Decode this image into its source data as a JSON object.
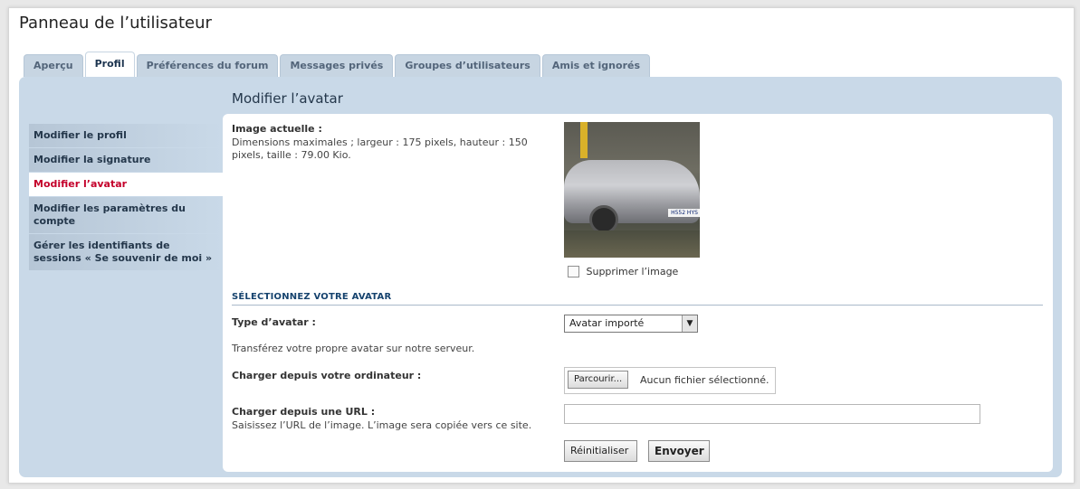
{
  "page": {
    "title": "Panneau de l’utilisateur"
  },
  "tabs": [
    {
      "label": "Aperçu"
    },
    {
      "label": "Profil"
    },
    {
      "label": "Préférences du forum"
    },
    {
      "label": "Messages privés"
    },
    {
      "label": "Groupes d’utilisateurs"
    },
    {
      "label": "Amis et ignorés"
    }
  ],
  "sidebar": {
    "items": [
      {
        "label": "Modifier le profil"
      },
      {
        "label": "Modifier la signature"
      },
      {
        "label": "Modifier l’avatar"
      },
      {
        "label": "Modifier les paramètres du compte"
      },
      {
        "label": "Gérer les identifiants de sessions « Se souvenir de moi »"
      }
    ]
  },
  "main": {
    "heading": "Modifier l’avatar",
    "current_image_label": "Image actuelle :",
    "current_image_desc": "Dimensions maximales ; largeur : 175 pixels, hauteur : 150 pixels, taille : 79.00 Kio.",
    "avatar_plate_text": "H552 HYS",
    "delete_image_label": "Supprimer l’image",
    "section_title": "SÉLECTIONNEZ VOTRE AVATAR",
    "avatar_type_label": "Type d’avatar :",
    "avatar_type_value": "Avatar importé",
    "upload_desc": "Transférez votre propre avatar sur notre serveur.",
    "upload_label": "Charger depuis votre ordinateur :",
    "browse_button": "Parcourir...",
    "no_file_text": "Aucun fichier sélectionné.",
    "url_label": "Charger depuis une URL :",
    "url_desc": "Saisissez l’URL de l’image. L’image sera copiée vers ce site.",
    "url_value": "",
    "reset_button": "Réinitialiser",
    "submit_button": "Envoyer"
  },
  "colors": {
    "panel_bg": "#c9d9e8",
    "active_sidebar_text": "#c4002b",
    "section_title": "#16436e"
  }
}
